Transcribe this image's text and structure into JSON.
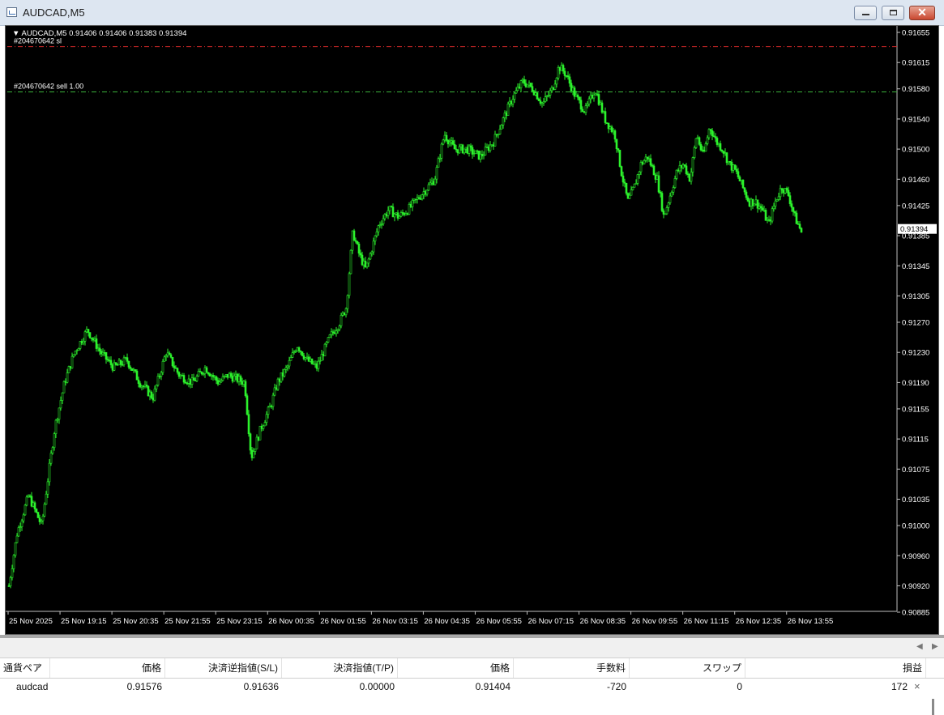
{
  "window": {
    "title": "AUDCAD,M5",
    "buttons": {
      "minimize": "minimize",
      "maximize": "maximize",
      "close": "close"
    }
  },
  "chart_header": {
    "arrow": "▼",
    "symbol": "AUDCAD,M5",
    "ohlc": "0.91406 0.91406 0.91383 0.91394"
  },
  "order_lines": [
    {
      "label": "#204670642 sl",
      "price": 0.91636,
      "color": "#d42a2a"
    },
    {
      "label": "#204670642 sell 1.00",
      "price": 0.91576,
      "color": "#3cb43c"
    }
  ],
  "colors": {
    "background": "#000000",
    "candle": "#2cf22c",
    "axis_text": "#ffffff",
    "price_tag_bg": "#ffffff",
    "price_tag_text": "#000000"
  },
  "chart_data": {
    "type": "candlestick",
    "symbol": "AUDCAD",
    "timeframe": "M5",
    "current_price": 0.91394,
    "y_ticks": [
      "0.91655",
      "0.91615",
      "0.91580",
      "0.91540",
      "0.91500",
      "0.91460",
      "0.91425",
      "0.91385",
      "0.91345",
      "0.91305",
      "0.91270",
      "0.91230",
      "0.91190",
      "0.91155",
      "0.91115",
      "0.91075",
      "0.91035",
      "0.91000",
      "0.90960",
      "0.90920",
      "0.90885"
    ],
    "y_range": [
      0.90885,
      0.91655
    ],
    "x_ticks": [
      "25 Nov 2025",
      "25 Nov 19:15",
      "25 Nov 20:35",
      "25 Nov 21:55",
      "25 Nov 23:15",
      "26 Nov 00:35",
      "26 Nov 01:55",
      "26 Nov 03:15",
      "26 Nov 04:35",
      "26 Nov 05:55",
      "26 Nov 07:15",
      "26 Nov 08:35",
      "26 Nov 09:55",
      "26 Nov 11:15",
      "26 Nov 12:35",
      "26 Nov 13:55"
    ],
    "close_path": [
      [
        0,
        0.9092
      ],
      [
        5,
        0.9099
      ],
      [
        12,
        0.9104
      ],
      [
        20,
        0.91
      ],
      [
        28,
        0.9113
      ],
      [
        34,
        0.9119
      ],
      [
        40,
        0.9123
      ],
      [
        48,
        0.9126
      ],
      [
        56,
        0.9123
      ],
      [
        64,
        0.9121
      ],
      [
        72,
        0.9122
      ],
      [
        80,
        0.9119
      ],
      [
        88,
        0.9117
      ],
      [
        96,
        0.9123
      ],
      [
        104,
        0.912
      ],
      [
        112,
        0.9119
      ],
      [
        120,
        0.9121
      ],
      [
        128,
        0.9119
      ],
      [
        134,
        0.912
      ],
      [
        144,
        0.9119
      ],
      [
        148,
        0.9109
      ],
      [
        154,
        0.9113
      ],
      [
        160,
        0.9116
      ],
      [
        164,
        0.9119
      ],
      [
        170,
        0.9121
      ],
      [
        176,
        0.9124
      ],
      [
        182,
        0.9122
      ],
      [
        188,
        0.9121
      ],
      [
        196,
        0.9125
      ],
      [
        202,
        0.9127
      ],
      [
        206,
        0.9129
      ],
      [
        210,
        0.9139
      ],
      [
        214,
        0.9136
      ],
      [
        218,
        0.9134
      ],
      [
        222,
        0.9137
      ],
      [
        226,
        0.914
      ],
      [
        232,
        0.9142
      ],
      [
        238,
        0.9141
      ],
      [
        244,
        0.9142
      ],
      [
        252,
        0.9144
      ],
      [
        260,
        0.9146
      ],
      [
        266,
        0.9152
      ],
      [
        272,
        0.915
      ],
      [
        280,
        0.915
      ],
      [
        288,
        0.9149
      ],
      [
        296,
        0.9151
      ],
      [
        302,
        0.9154
      ],
      [
        308,
        0.9157
      ],
      [
        314,
        0.9159
      ],
      [
        320,
        0.9158
      ],
      [
        326,
        0.9156
      ],
      [
        332,
        0.9158
      ],
      [
        336,
        0.9161
      ],
      [
        340,
        0.916
      ],
      [
        346,
        0.9157
      ],
      [
        352,
        0.9155
      ],
      [
        358,
        0.9158
      ],
      [
        364,
        0.9154
      ],
      [
        370,
        0.9152
      ],
      [
        374,
        0.9147
      ],
      [
        378,
        0.9143
      ],
      [
        382,
        0.9145
      ],
      [
        386,
        0.9148
      ],
      [
        390,
        0.9149
      ],
      [
        396,
        0.9146
      ],
      [
        400,
        0.9141
      ],
      [
        404,
        0.9144
      ],
      [
        408,
        0.9147
      ],
      [
        412,
        0.9148
      ],
      [
        416,
        0.9146
      ],
      [
        420,
        0.9152
      ],
      [
        424,
        0.9149
      ],
      [
        428,
        0.9153
      ],
      [
        432,
        0.9151
      ],
      [
        436,
        0.915
      ],
      [
        440,
        0.9148
      ],
      [
        444,
        0.9147
      ],
      [
        448,
        0.9145
      ],
      [
        452,
        0.9143
      ],
      [
        456,
        0.9143
      ],
      [
        460,
        0.9142
      ],
      [
        464,
        0.914
      ],
      [
        468,
        0.9143
      ],
      [
        472,
        0.9145
      ],
      [
        476,
        0.9144
      ],
      [
        480,
        0.9141
      ],
      [
        484,
        0.9139
      ]
    ]
  },
  "price_tag": "0.91394",
  "terminal": {
    "columns": [
      "通貨ペア",
      "価格",
      "決済逆指値(S/L)",
      "決済指値(T/P)",
      "価格",
      "手数料",
      "スワップ",
      "損益"
    ],
    "sort_indicator": "/",
    "rows": [
      {
        "symbol": "audcad",
        "open_price": "0.91576",
        "sl": "0.91636",
        "tp": "0.00000",
        "price": "0.91404",
        "commission": "-720",
        "swap": "0",
        "profit": "172",
        "close": "×"
      }
    ],
    "scroll_left": "◀",
    "scroll_right": "▶"
  }
}
